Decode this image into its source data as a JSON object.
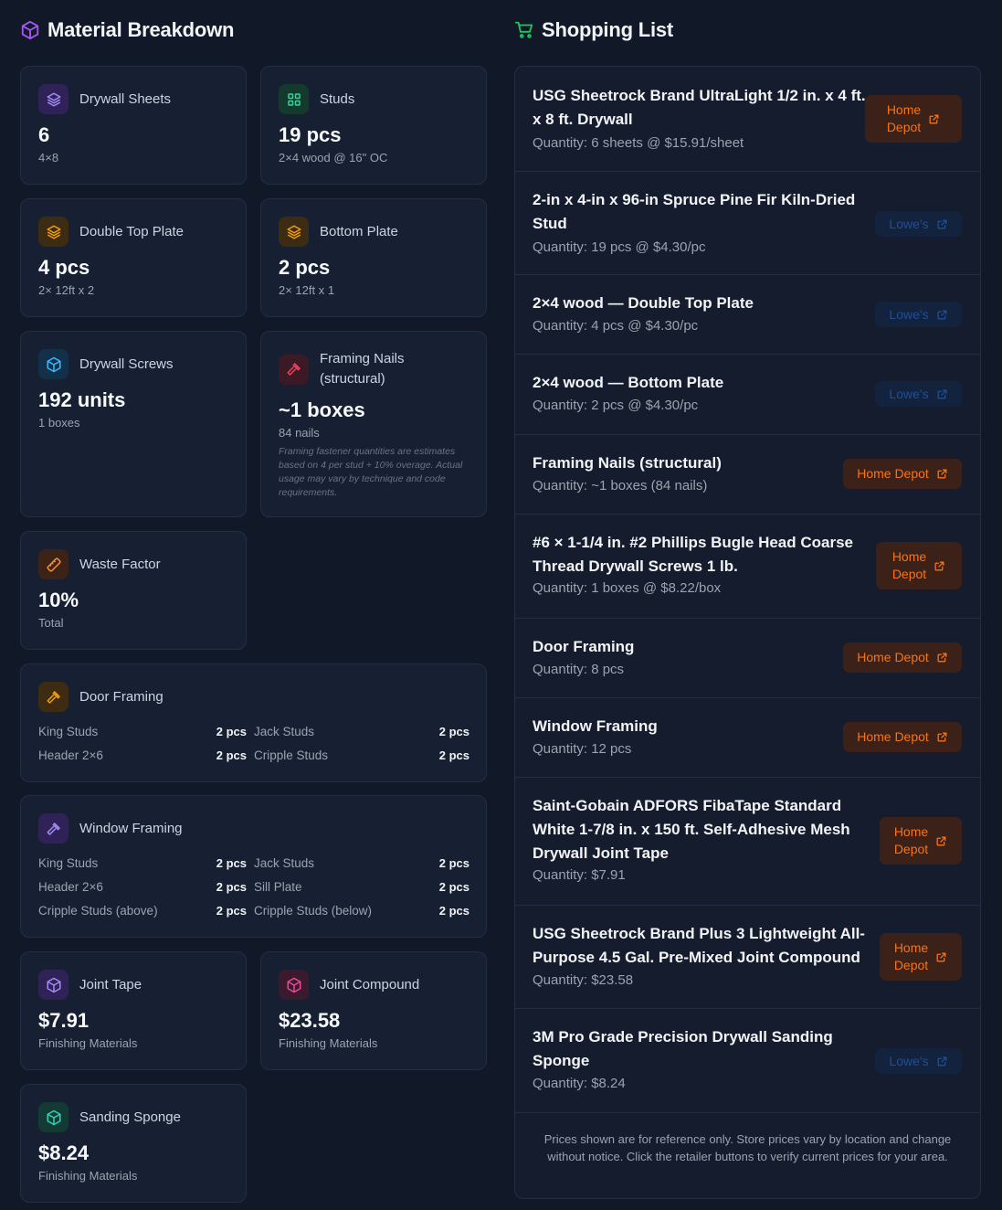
{
  "left": {
    "title": "Material Breakdown",
    "cards": {
      "drywall_sheets": {
        "label": "Drywall Sheets",
        "value": "6",
        "sub": "4×8"
      },
      "studs": {
        "label": "Studs",
        "value": "19 pcs",
        "sub": "2×4 wood @ 16\" OC"
      },
      "double_top_plate": {
        "label": "Double Top Plate",
        "value": "4 pcs",
        "sub": "2× 12ft x 2"
      },
      "bottom_plate": {
        "label": "Bottom Plate",
        "value": "2 pcs",
        "sub": "2× 12ft x 1"
      },
      "drywall_screws": {
        "label": "Drywall Screws",
        "value": "192 units",
        "sub": "1 boxes"
      },
      "framing_nails": {
        "label_line1": "Framing Nails",
        "label_line2": "(structural)",
        "value": "~1 boxes",
        "sub": "84 nails",
        "note": "Framing fastener quantities are estimates based on 4 per stud + 10% overage. Actual usage may vary by technique and code requirements."
      },
      "waste_factor": {
        "label": "Waste Factor",
        "value": "10%",
        "sub": "Total"
      },
      "door_framing": {
        "label": "Door Framing",
        "rows": [
          {
            "a_label": "King Studs",
            "a_val": "2 pcs",
            "b_label": "Jack Studs",
            "b_val": "2 pcs"
          },
          {
            "a_label": "Header 2×6",
            "a_val": "2 pcs",
            "b_label": "Cripple Studs",
            "b_val": "2 pcs"
          }
        ]
      },
      "window_framing": {
        "label": "Window Framing",
        "rows": [
          {
            "a_label": "King Studs",
            "a_val": "2 pcs",
            "b_label": "Jack Studs",
            "b_val": "2 pcs"
          },
          {
            "a_label": "Header 2×6",
            "a_val": "2 pcs",
            "b_label": "Sill Plate",
            "b_val": "2 pcs"
          },
          {
            "a_label": "Cripple Studs (above)",
            "a_val": "2 pcs",
            "b_label": "Cripple Studs (below)",
            "b_val": "2 pcs"
          }
        ]
      },
      "joint_tape": {
        "label": "Joint Tape",
        "value": "$7.91",
        "sub": "Finishing Materials"
      },
      "joint_compound": {
        "label": "Joint Compound",
        "value": "$23.58",
        "sub": "Finishing Materials"
      },
      "sanding_sponge": {
        "label": "Sanding Sponge",
        "value": "$8.24",
        "sub": "Finishing Materials"
      }
    }
  },
  "right": {
    "title": "Shopping List",
    "items": [
      {
        "name": "USG Sheetrock Brand UltraLight 1/2 in. x 4 ft. x 8 ft. Drywall",
        "qty": "Quantity: 6 sheets @ $15.91/sheet",
        "store_l1": "Home",
        "store_l2": "Depot"
      },
      {
        "name": "2-in x 4-in x 96-in Spruce Pine Fir Kiln-Dried Stud",
        "qty": "Quantity: 19 pcs @ $4.30/pc",
        "store": "Lowe's"
      },
      {
        "name": "2×4 wood — Double Top Plate",
        "qty": "Quantity: 4 pcs @ $4.30/pc",
        "store": "Lowe's"
      },
      {
        "name": "2×4 wood — Bottom Plate",
        "qty": "Quantity: 2 pcs @ $4.30/pc",
        "store": "Lowe's"
      },
      {
        "name": "Framing Nails (structural)",
        "qty": "Quantity: ~1 boxes (84 nails)",
        "store": "Home Depot"
      },
      {
        "name": "#6 × 1-1/4 in. #2 Phillips Bugle Head Coarse Thread Drywall Screws 1 lb.",
        "qty": "Quantity: 1 boxes @ $8.22/box",
        "store_l1": "Home",
        "store_l2": "Depot"
      },
      {
        "name": "Door Framing",
        "qty": "Quantity: 8 pcs",
        "store": "Home Depot"
      },
      {
        "name": "Window Framing",
        "qty": "Quantity: 12 pcs",
        "store": "Home Depot"
      },
      {
        "name": "Saint-Gobain ADFORS FibaTape Standard White 1-7/8 in. x 150 ft. Self-Adhesive Mesh Drywall Joint Tape",
        "qty": "Quantity: $7.91",
        "store_l1": "Home",
        "store_l2": "Depot"
      },
      {
        "name": "USG Sheetrock Brand Plus 3 Lightweight All-Purpose 4.5 Gal. Pre-Mixed Joint Compound",
        "qty": "Quantity: $23.58",
        "store_l1": "Home",
        "store_l2": "Depot"
      },
      {
        "name": "3M Pro Grade Precision Drywall Sanding Sponge",
        "qty": "Quantity: $8.24",
        "store": "Lowe's"
      }
    ],
    "footer": "Prices shown are for reference only. Store prices vary by location and change without notice. Click the retailer buttons to verify current prices for your area."
  },
  "colors": {
    "background": "#111827",
    "card": "#172033",
    "home_depot": "#f97316",
    "lowes": "#1d4f9a",
    "accent_purple": "#a855f7",
    "accent_green": "#22c55e"
  }
}
